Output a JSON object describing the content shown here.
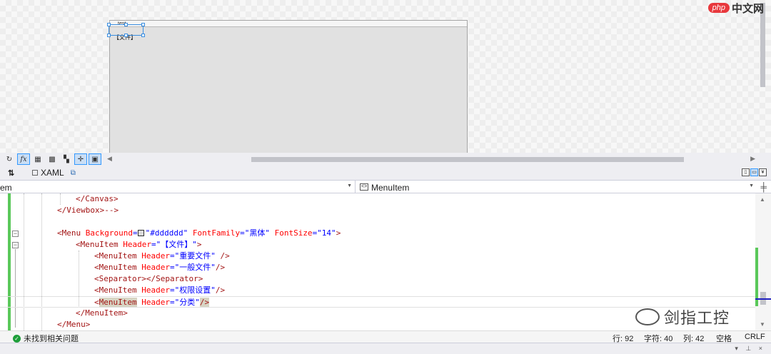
{
  "designer": {
    "window_title": "test",
    "menu_item_header": "【文件】",
    "logo_badge": "php",
    "logo_text": "中文网"
  },
  "tabstrip": {
    "swap_icon": "⇅",
    "xaml_tab": "XAML"
  },
  "navbar": {
    "left_value": "em",
    "right_icon": "<>",
    "right_value": "MenuItem"
  },
  "code": {
    "l1": "</Canvas>",
    "l2_tag": "</Viewbox>",
    "l2_comment": "-->",
    "l4_menu": "<Menu ",
    "l4_bg_attr": "Background",
    "l4_bg_val": "\"#dddddd\"",
    "l4_ff_attr": "FontFamily",
    "l4_ff_val": "\"黑体\"",
    "l4_fs_attr": "FontSize",
    "l4_fs_val": "\"14\"",
    "l5_tag": "<MenuItem ",
    "l5_attr": "Header",
    "l5_val": "\"【文件】\"",
    "l6_val": "\"重要文件\"",
    "l7_val": "\"一般文件\"",
    "l8": "<Separator></Separator>",
    "l9_val": "\"权限设置\"",
    "l10_val": "\"分类\"",
    "l11": "</MenuItem>",
    "l12": "</Menu>",
    "menuitem_tag": "<MenuItem ",
    "menuitem_tag_hl": "MenuItem",
    "header_attr": "Header",
    "self_close": " />",
    "self_close_tight": "/>"
  },
  "watermark": "剑指工控",
  "status": {
    "message": "未找到相关问题",
    "line": "行: 92",
    "char": "字符: 40",
    "col": "列: 42",
    "mode": "空格",
    "eol": "CRLF"
  },
  "colors": {
    "accent": "#3399ff",
    "change_bar": "#5ac85a",
    "success": "#1e9e3a",
    "menu_background": "#dddddd"
  }
}
